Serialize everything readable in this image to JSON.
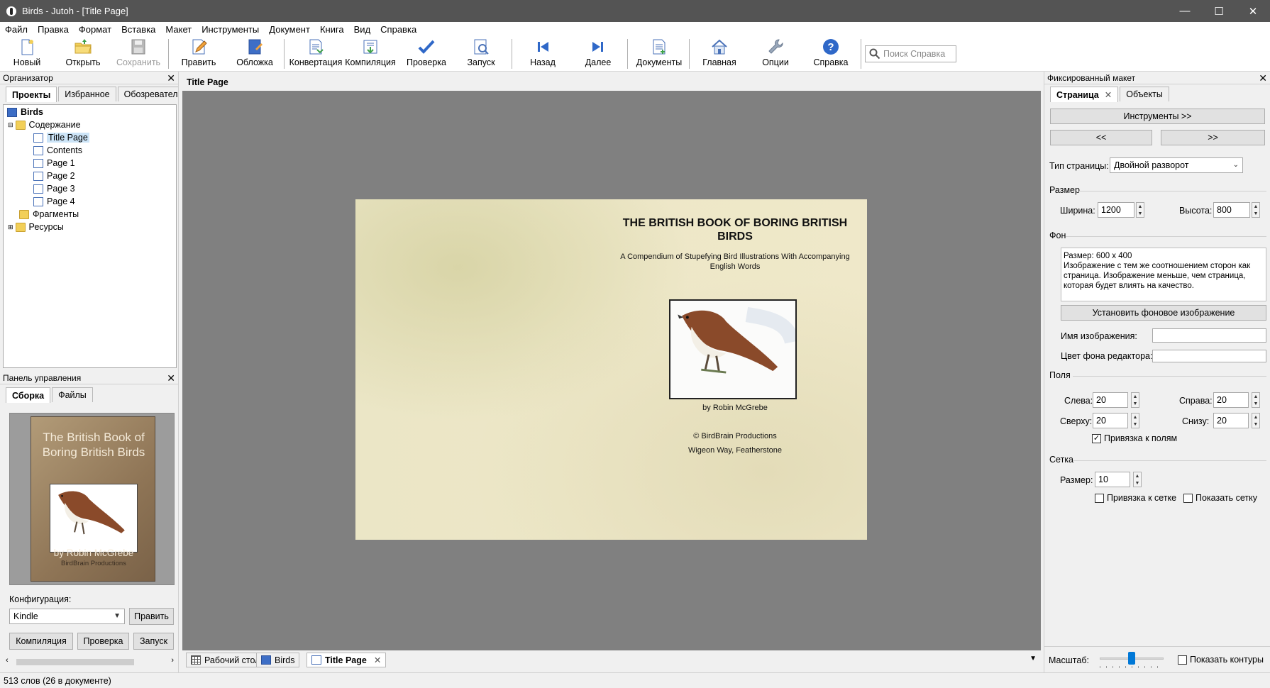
{
  "window": {
    "title": "Birds - Jutoh - [Title Page]",
    "minimize": "—",
    "maximize": "☐",
    "close": "✕"
  },
  "menu": [
    "Файл",
    "Правка",
    "Формат",
    "Вставка",
    "Макет",
    "Инструменты",
    "Документ",
    "Книга",
    "Вид",
    "Справка"
  ],
  "toolbar": {
    "new": "Новый",
    "open": "Открыть",
    "save": "Сохранить",
    "edit": "Править",
    "cover": "Обложка",
    "convert": "Конвертация",
    "compile": "Компиляция",
    "check": "Проверка",
    "launch": "Запуск",
    "back": "Назад",
    "forward": "Далее",
    "documents": "Документы",
    "home": "Главная",
    "options": "Опции",
    "help": "Справка",
    "search_placeholder": "Поиск Справка"
  },
  "organizer": {
    "title": "Организатор",
    "tabs": [
      "Проекты",
      "Избранное",
      "Обозреватель"
    ],
    "tree": {
      "root": "Birds",
      "content_folder": "Содержание",
      "pages": [
        "Title Page",
        "Contents",
        "Page 1",
        "Page 2",
        "Page 3",
        "Page 4"
      ],
      "fragments": "Фрагменты",
      "resources": "Ресурсы"
    }
  },
  "control_panel": {
    "title": "Панель управления",
    "tabs": [
      "Сборка",
      "Файлы"
    ],
    "cover": {
      "title": "The British Book of Boring British Birds",
      "author": "by Robin McGrebe",
      "publisher": "BirdBrain Productions"
    },
    "config_label": "Конфигурация:",
    "config_value": "Kindle",
    "edit_button": "Править",
    "compile_button": "Компиляция",
    "check_button": "Проверка",
    "launch_button": "Запуск"
  },
  "document": {
    "header": "Title Page",
    "page": {
      "title": "THE BRITISH BOOK OF BORING BRITISH BIRDS",
      "subtitle": "A Compendium of Stupefying Bird Illustrations With Accompanying English Words",
      "author": "by Robin McGrebe",
      "copyright": "© BirdBrain Productions",
      "address": "Wigeon Way, Featherstone"
    },
    "tabs": [
      "Рабочий стол",
      "Birds",
      "Title Page"
    ]
  },
  "status": {
    "text": "513 слов (26 в документе)"
  },
  "fixed_layout": {
    "title": "Фиксированный макет",
    "tabs": [
      "Страница",
      "Объекты"
    ],
    "tools_button": "Инструменты >>",
    "prev_button": "<<",
    "next_button": ">>",
    "page_type_label": "Тип страницы:",
    "page_type_value": "Двойной разворот",
    "size_group": "Размер",
    "width_label": "Ширина:",
    "width_value": "1200",
    "height_label": "Высота:",
    "height_value": "800",
    "bg_group": "Фон",
    "bg_info": "Размер: 600 x 400\nИзображение с тем же соотношением сторон как страница. Изображение меньше, чем страница, которая будет влиять на качество.",
    "set_bg_button": "Установить фоновое изображение",
    "image_name_label": "Имя изображения:",
    "editor_bg_label": "Цвет фона редактора:",
    "margins_group": "Поля",
    "left_label": "Слева:",
    "left_value": "20",
    "right_label": "Справа:",
    "right_value": "20",
    "top_label": "Сверху:",
    "top_value": "20",
    "bottom_label": "Снизу:",
    "bottom_value": "20",
    "snap_margins_label": "Привязка к полям",
    "snap_margins_checked": true,
    "grid_group": "Сетка",
    "grid_size_label": "Размер:",
    "grid_size_value": "10",
    "snap_grid_label": "Привязка к сетке",
    "show_grid_label": "Показать сетку",
    "zoom_label": "Масштаб:",
    "show_outlines_label": "Показать контуры"
  },
  "colors": {
    "accent": "#3d6ec6",
    "canvas": "#808080",
    "page": "#ece5c4",
    "folder": "#f2cf58"
  }
}
